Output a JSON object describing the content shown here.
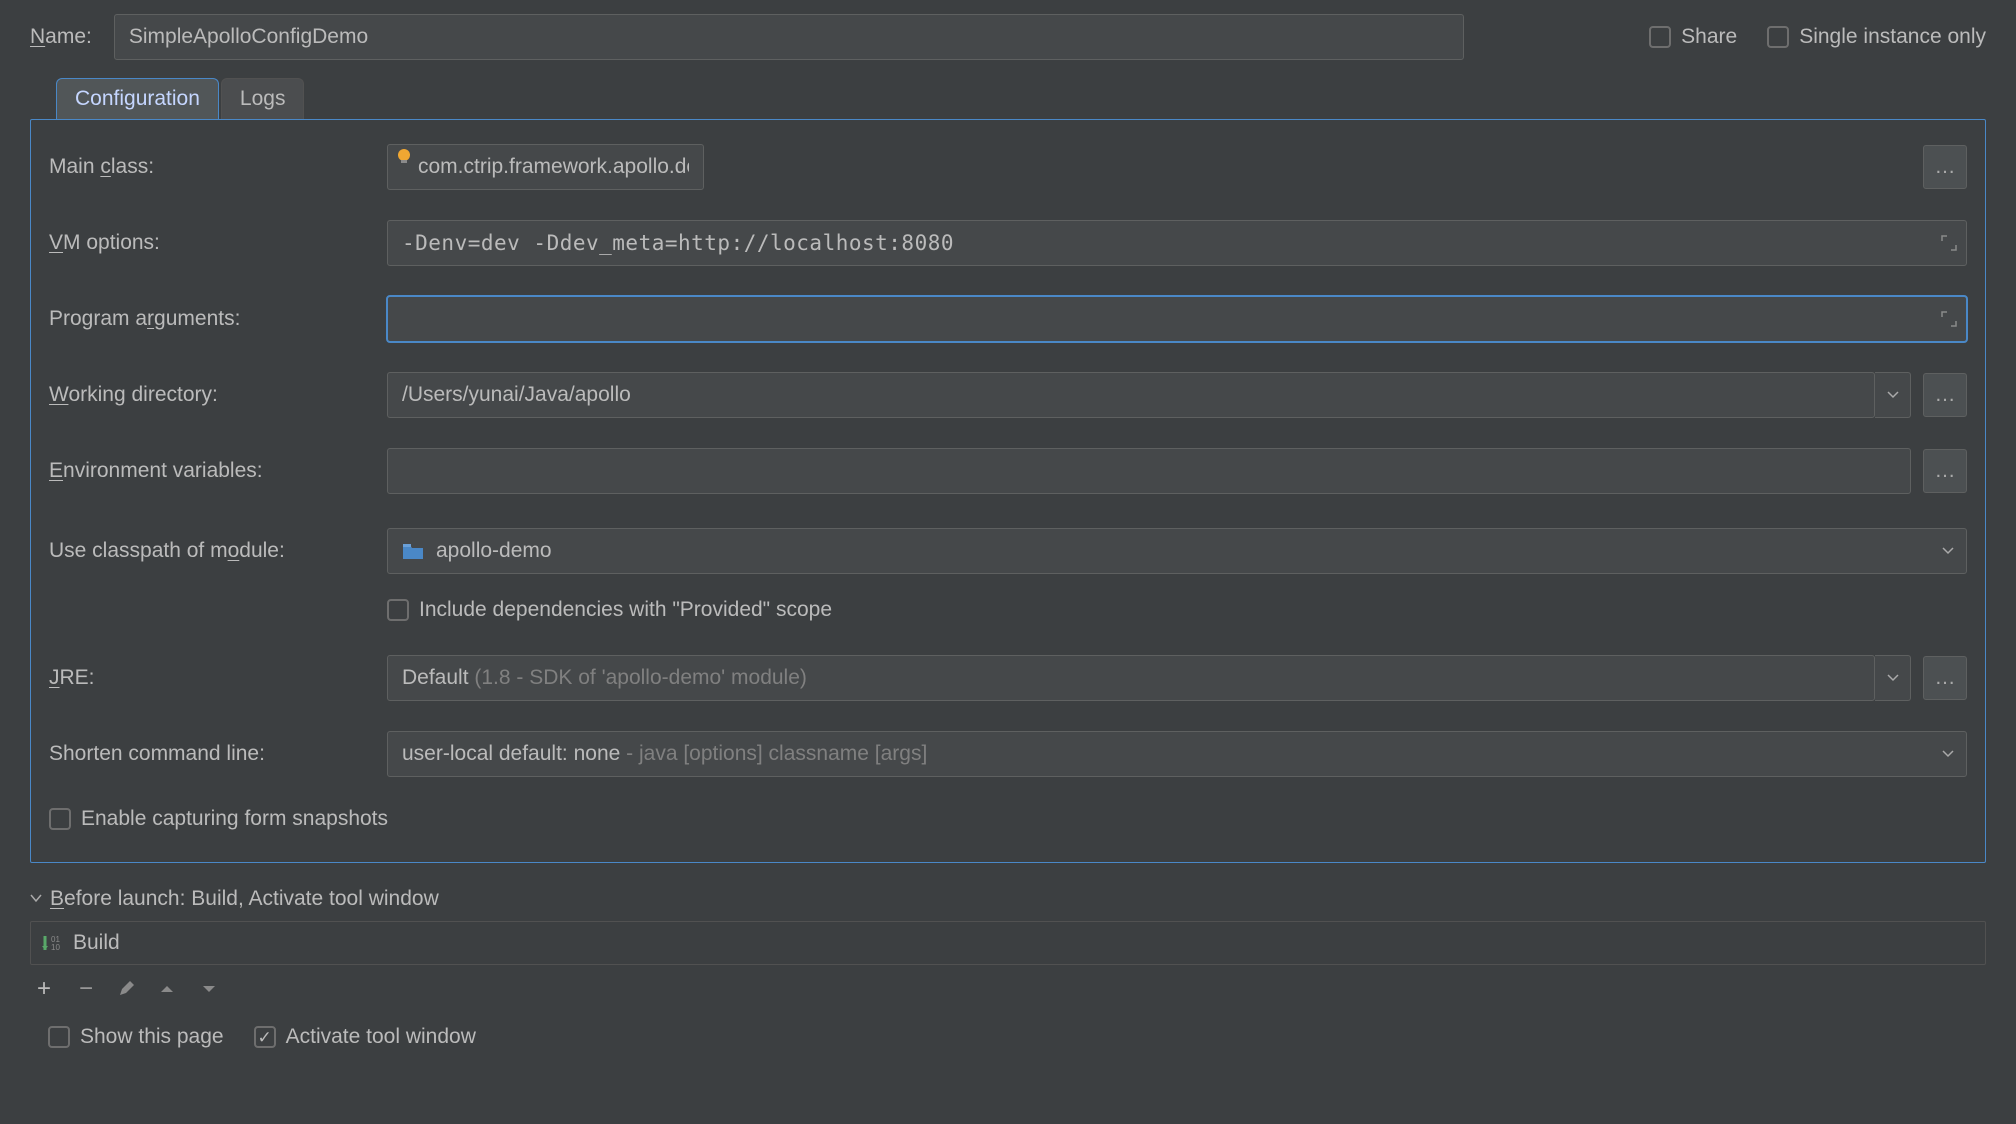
{
  "top": {
    "name_label_pre": "N",
    "name_label_post": "ame:",
    "name_value": "SimpleApolloConfigDemo",
    "share_label": "Share",
    "single_label": "Single instance only"
  },
  "tabs": {
    "configuration": "Configuration",
    "logs": "Logs"
  },
  "form": {
    "main_class_label_pre": "Main ",
    "main_class_u": "c",
    "main_class_label_post": "lass:",
    "main_class_value": "com.ctrip.framework.apollo.demo.api.SimpleApolloConfigDemo",
    "vm_u": "V",
    "vm_label_post": "M options:",
    "vm_value": "-Denv=dev -Ddev_meta=http://localhost:8080",
    "args_label_pre": "Program a",
    "args_u": "r",
    "args_label_post": "guments:",
    "args_value": "",
    "wd_u": "W",
    "wd_label_post": "orking directory:",
    "wd_value": "/Users/yunai/Java/apollo",
    "env_u": "E",
    "env_label_post": "nvironment variables:",
    "env_value": "",
    "module_label_pre": "Use classpath of m",
    "module_u": "o",
    "module_label_post": "dule:",
    "module_value": "apollo-demo",
    "include_provided": "Include dependencies with \"Provided\" scope",
    "jre_u": "J",
    "jre_label_post": "RE:",
    "jre_main": "Default",
    "jre_hint": " (1.8 - SDK of 'apollo-demo' module)",
    "shorten_label": "Shorten command line:",
    "shorten_main": "user-local default: none",
    "shorten_hint": " - java [options] classname [args]",
    "enable_snapshots": "Enable capturing form snapshots"
  },
  "before_launch": {
    "header_u": "B",
    "header_post": "efore launch: Build, Activate tool window",
    "item": "Build"
  },
  "bottom": {
    "show_page": "Show this page",
    "activate": "Activate tool window"
  }
}
